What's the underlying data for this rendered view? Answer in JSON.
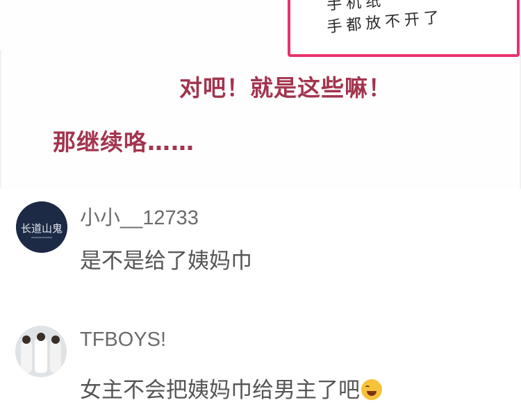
{
  "panel": {
    "note_line1": "手机纸",
    "note_line2": "手都放不开了",
    "caption1": "对吧！就是这些嘛！",
    "caption2": "那继续咯……"
  },
  "comments": [
    {
      "username": "小小__12733",
      "text": "是不是给了姨妈巾",
      "avatar_text": "长道山鬼"
    },
    {
      "username": "TFBOYS!",
      "text": "女主不会把姨妈巾给男主了吧"
    }
  ],
  "colors": {
    "caption": "#a3344e",
    "note_border": "#e8326a",
    "username": "#6b6b6b",
    "comment_text": "#555555"
  },
  "icons": {
    "emoji": "tears-of-joy-emoji"
  }
}
